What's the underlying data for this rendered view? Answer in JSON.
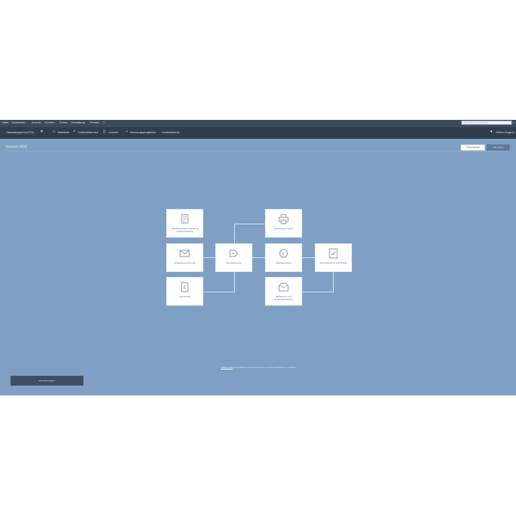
{
  "menubar": {
    "items": [
      "Datei",
      "Bearbeiten",
      "Ansicht",
      "Buchen",
      "Extras",
      "Verwaltung",
      "Fenster",
      "?"
    ],
    "search_placeholder": "Suche (Strg+Umschalt+F)",
    "collapse_glyph": "x"
  },
  "toolbar": {
    "dropdown_label": "Hauptprogramm (F12)",
    "items": [
      "Startseite",
      "Dokumente neu",
      "Ansicht",
      "Buchungsprogramm",
      "Kontenjournal"
    ],
    "support_label": "Online-Support"
  },
  "page": {
    "title": "Versuch 2019",
    "btn_left": "Letzte Aktivität",
    "btn_right": "Alle zeigen"
  },
  "workflow": {
    "cards": [
      {
        "id": "c1",
        "label": "Ablaufdarstellung / Rechnung Auftragsrechnung",
        "icon": "document-list-icon"
      },
      {
        "id": "c2",
        "label": "Eingangsrechnung (E)",
        "icon": "envelope-icon"
      },
      {
        "id": "c3",
        "label": "Lieferschein",
        "icon": "receipt-icon"
      },
      {
        "id": "c4",
        "label": "Belegerfassung",
        "icon": "arrow-box-icon"
      },
      {
        "id": "c5",
        "label": "Rechnungen buchen",
        "icon": "printer-icon"
      },
      {
        "id": "c6",
        "label": "Zahlungsverkehr",
        "icon": "payment-cycle-icon"
      },
      {
        "id": "c7",
        "label": "Bankkonten und Finanzbuchhaltung",
        "icon": "inbox-icon"
      },
      {
        "id": "c8",
        "label": "Jahresabschluss durchführen",
        "icon": "shield-check-icon"
      }
    ]
  },
  "hint": {
    "link": "Weitere Infos",
    "text": "zum Arbeiten mit dem Assistenten und den Startseiten im Lexware"
  },
  "bottom_button": "Startseite wählen",
  "colors": {
    "workspace": "#7f9fc4",
    "menubar": "#3a4a5c",
    "toolbar": "#2f3d4d",
    "card": "#ffffff"
  }
}
